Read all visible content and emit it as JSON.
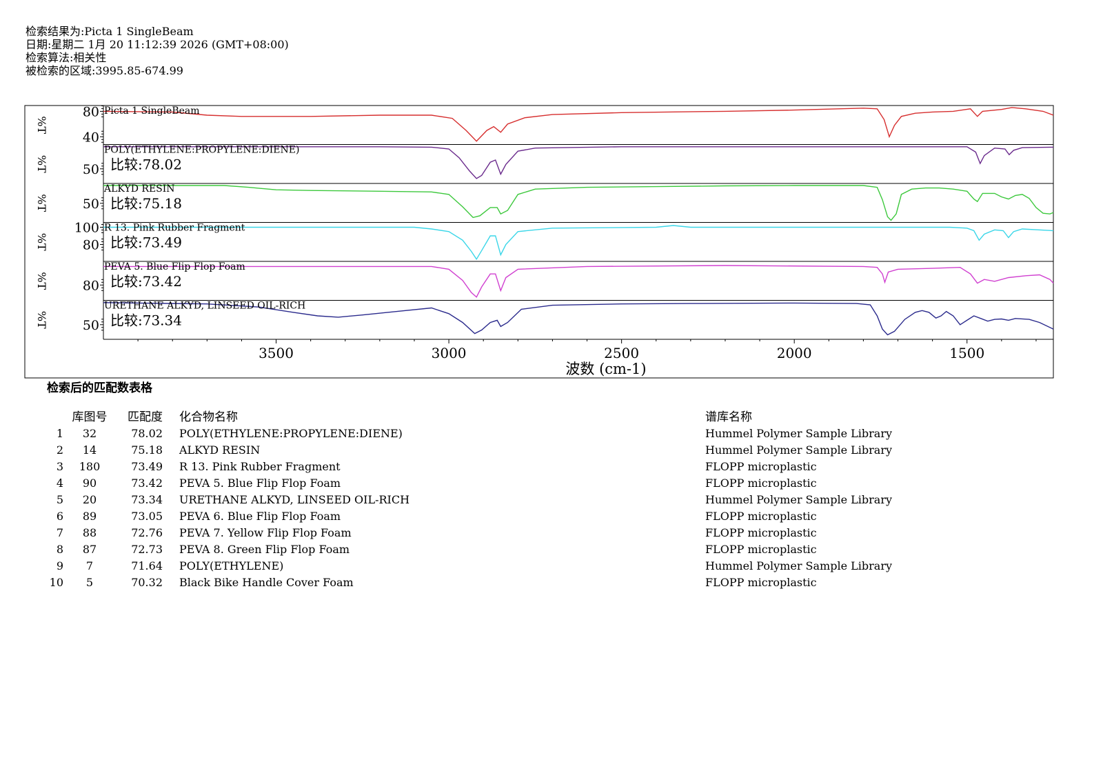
{
  "header": {
    "line1": "检索结果为:Picta 1 SingleBeam",
    "line2": "日期:星期二 1月 20 11:12:39 2026 (GMT+08:00)",
    "line3": "检索算法:相关性",
    "line4": "被检索的区域:3995.85-674.99"
  },
  "chart_data": {
    "type": "line",
    "xlabel": "波数 (cm-1)",
    "ylabel": "%T",
    "x_reversed": true,
    "xlim": [
      4000,
      1250
    ],
    "x_ticks": [
      3500,
      3000,
      2500,
      2000,
      1500
    ],
    "match_prefix": "比较:",
    "series": [
      {
        "name": "Picta 1 SingleBeam",
        "color": "#d62e2e",
        "score": "",
        "y_ticks": [
          80,
          40
        ],
        "ylim": [
          30,
          87
        ],
        "points": [
          [
            4000,
            80
          ],
          [
            3800,
            79
          ],
          [
            3700,
            74
          ],
          [
            3600,
            72
          ],
          [
            3400,
            72
          ],
          [
            3200,
            74
          ],
          [
            3050,
            74
          ],
          [
            2990,
            69
          ],
          [
            2950,
            50
          ],
          [
            2920,
            33
          ],
          [
            2890,
            50
          ],
          [
            2870,
            56
          ],
          [
            2850,
            47
          ],
          [
            2830,
            60
          ],
          [
            2780,
            70
          ],
          [
            2700,
            75
          ],
          [
            2500,
            78
          ],
          [
            2200,
            80
          ],
          [
            2000,
            82
          ],
          [
            1800,
            85
          ],
          [
            1760,
            84
          ],
          [
            1740,
            67
          ],
          [
            1725,
            40
          ],
          [
            1710,
            58
          ],
          [
            1690,
            72
          ],
          [
            1650,
            77
          ],
          [
            1600,
            79
          ],
          [
            1540,
            80
          ],
          [
            1490,
            84
          ],
          [
            1470,
            72
          ],
          [
            1455,
            80
          ],
          [
            1400,
            83
          ],
          [
            1370,
            86
          ],
          [
            1330,
            84
          ],
          [
            1280,
            80
          ],
          [
            1250,
            74
          ]
        ]
      },
      {
        "name": "POLY(ETHYLENE:PROPYLENE:DIENE)",
        "color": "#6a2a8c",
        "score": "78.02",
        "y_ticks": [
          50
        ],
        "ylim": [
          20,
          102
        ],
        "points": [
          [
            4000,
            100
          ],
          [
            3200,
            100
          ],
          [
            3050,
            99
          ],
          [
            3000,
            95
          ],
          [
            2970,
            75
          ],
          [
            2940,
            45
          ],
          [
            2920,
            28
          ],
          [
            2905,
            35
          ],
          [
            2880,
            65
          ],
          [
            2865,
            70
          ],
          [
            2850,
            38
          ],
          [
            2835,
            60
          ],
          [
            2800,
            90
          ],
          [
            2750,
            97
          ],
          [
            2500,
            100
          ],
          [
            1500,
            100
          ],
          [
            1475,
            88
          ],
          [
            1462,
            62
          ],
          [
            1450,
            80
          ],
          [
            1420,
            97
          ],
          [
            1390,
            95
          ],
          [
            1378,
            82
          ],
          [
            1365,
            92
          ],
          [
            1340,
            98
          ],
          [
            1250,
            99
          ]
        ]
      },
      {
        "name": "ALKYD RESIN",
        "color": "#3cc83c",
        "score": "75.18",
        "y_ticks": [
          50
        ],
        "ylim": [
          0,
          102
        ],
        "points": [
          [
            4000,
            100
          ],
          [
            3650,
            100
          ],
          [
            3580,
            95
          ],
          [
            3500,
            88
          ],
          [
            3400,
            86
          ],
          [
            3200,
            84
          ],
          [
            3050,
            82
          ],
          [
            3000,
            75
          ],
          [
            2960,
            40
          ],
          [
            2930,
            10
          ],
          [
            2910,
            15
          ],
          [
            2880,
            38
          ],
          [
            2860,
            38
          ],
          [
            2850,
            20
          ],
          [
            2830,
            30
          ],
          [
            2800,
            75
          ],
          [
            2750,
            90
          ],
          [
            2600,
            95
          ],
          [
            2400,
            97
          ],
          [
            2200,
            99
          ],
          [
            2000,
            100
          ],
          [
            1800,
            100
          ],
          [
            1760,
            95
          ],
          [
            1745,
            60
          ],
          [
            1730,
            12
          ],
          [
            1720,
            2
          ],
          [
            1705,
            20
          ],
          [
            1690,
            75
          ],
          [
            1660,
            90
          ],
          [
            1620,
            93
          ],
          [
            1580,
            93
          ],
          [
            1540,
            90
          ],
          [
            1500,
            84
          ],
          [
            1480,
            62
          ],
          [
            1470,
            55
          ],
          [
            1455,
            78
          ],
          [
            1420,
            78
          ],
          [
            1400,
            68
          ],
          [
            1380,
            62
          ],
          [
            1360,
            72
          ],
          [
            1340,
            75
          ],
          [
            1320,
            64
          ],
          [
            1300,
            38
          ],
          [
            1280,
            22
          ],
          [
            1260,
            20
          ],
          [
            1250,
            24
          ]
        ]
      },
      {
        "name": "R 13. Pink Rubber Fragment",
        "color": "#3ad6e8",
        "score": "73.49",
        "y_ticks": [
          100,
          80
        ],
        "ylim": [
          62,
          104
        ],
        "points": [
          [
            4000,
            100
          ],
          [
            3100,
            100
          ],
          [
            3050,
            98
          ],
          [
            3000,
            95
          ],
          [
            2960,
            85
          ],
          [
            2935,
            72
          ],
          [
            2920,
            63
          ],
          [
            2905,
            73
          ],
          [
            2880,
            90
          ],
          [
            2865,
            90
          ],
          [
            2850,
            68
          ],
          [
            2835,
            80
          ],
          [
            2800,
            95
          ],
          [
            2700,
            99
          ],
          [
            2400,
            100
          ],
          [
            2350,
            102
          ],
          [
            2300,
            100
          ],
          [
            1550,
            100
          ],
          [
            1500,
            99
          ],
          [
            1480,
            96
          ],
          [
            1465,
            85
          ],
          [
            1450,
            92
          ],
          [
            1420,
            97
          ],
          [
            1395,
            96
          ],
          [
            1380,
            88
          ],
          [
            1365,
            95
          ],
          [
            1340,
            98
          ],
          [
            1250,
            96
          ]
        ]
      },
      {
        "name": "PEVA 5. Blue Flip Flop Foam",
        "color": "#d040d0",
        "score": "73.42",
        "y_ticks": [
          80
        ],
        "ylim": [
          65,
          104
        ],
        "points": [
          [
            4000,
            100
          ],
          [
            3050,
            100
          ],
          [
            3000,
            97
          ],
          [
            2960,
            85
          ],
          [
            2935,
            72
          ],
          [
            2920,
            67
          ],
          [
            2905,
            78
          ],
          [
            2880,
            92
          ],
          [
            2865,
            92
          ],
          [
            2850,
            74
          ],
          [
            2835,
            88
          ],
          [
            2800,
            97
          ],
          [
            2600,
            100
          ],
          [
            2200,
            101
          ],
          [
            1800,
            100
          ],
          [
            1760,
            99
          ],
          [
            1745,
            92
          ],
          [
            1738,
            83
          ],
          [
            1728,
            94
          ],
          [
            1700,
            97
          ],
          [
            1600,
            98
          ],
          [
            1520,
            99
          ],
          [
            1490,
            92
          ],
          [
            1470,
            82
          ],
          [
            1450,
            86
          ],
          [
            1420,
            84
          ],
          [
            1380,
            88
          ],
          [
            1330,
            90
          ],
          [
            1290,
            91
          ],
          [
            1260,
            86
          ],
          [
            1250,
            82
          ]
        ]
      },
      {
        "name": "URETHANE ALKYD, LINSEED OIL-RICH",
        "color": "#2a2a8c",
        "score": "73.34",
        "y_ticks": [
          50
        ],
        "ylim": [
          20,
          102
        ],
        "points": [
          [
            4000,
            100
          ],
          [
            3700,
            97
          ],
          [
            3550,
            90
          ],
          [
            3450,
            78
          ],
          [
            3380,
            70
          ],
          [
            3320,
            67
          ],
          [
            3250,
            72
          ],
          [
            3150,
            80
          ],
          [
            3050,
            88
          ],
          [
            3000,
            75
          ],
          [
            2960,
            55
          ],
          [
            2925,
            30
          ],
          [
            2905,
            38
          ],
          [
            2880,
            55
          ],
          [
            2860,
            60
          ],
          [
            2850,
            46
          ],
          [
            2830,
            55
          ],
          [
            2790,
            85
          ],
          [
            2700,
            94
          ],
          [
            2500,
            97
          ],
          [
            2300,
            98
          ],
          [
            2000,
            99
          ],
          [
            1820,
            98
          ],
          [
            1780,
            95
          ],
          [
            1760,
            70
          ],
          [
            1745,
            40
          ],
          [
            1730,
            27
          ],
          [
            1710,
            35
          ],
          [
            1680,
            62
          ],
          [
            1650,
            78
          ],
          [
            1630,
            82
          ],
          [
            1610,
            78
          ],
          [
            1590,
            65
          ],
          [
            1575,
            70
          ],
          [
            1560,
            80
          ],
          [
            1540,
            70
          ],
          [
            1520,
            50
          ],
          [
            1500,
            60
          ],
          [
            1480,
            70
          ],
          [
            1460,
            64
          ],
          [
            1440,
            58
          ],
          [
            1420,
            62
          ],
          [
            1400,
            63
          ],
          [
            1380,
            60
          ],
          [
            1360,
            64
          ],
          [
            1320,
            62
          ],
          [
            1290,
            55
          ],
          [
            1250,
            40
          ]
        ]
      }
    ]
  },
  "table": {
    "title": "检索后的匹配数表格",
    "headers": {
      "lib": "库图号",
      "score": "匹配度",
      "name": "化合物名称",
      "lname": "谱库名称"
    },
    "rows": [
      {
        "idx": "1",
        "lib": "32",
        "score": "78.02",
        "name": "POLY(ETHYLENE:PROPYLENE:DIENE)",
        "lname": "Hummel Polymer Sample Library"
      },
      {
        "idx": "2",
        "lib": "14",
        "score": "75.18",
        "name": "ALKYD RESIN",
        "lname": "Hummel Polymer Sample Library"
      },
      {
        "idx": "3",
        "lib": "180",
        "score": "73.49",
        "name": "R 13. Pink Rubber Fragment",
        "lname": "FLOPP microplastic"
      },
      {
        "idx": "4",
        "lib": "90",
        "score": "73.42",
        "name": "PEVA 5. Blue Flip Flop Foam",
        "lname": "FLOPP microplastic"
      },
      {
        "idx": "5",
        "lib": "20",
        "score": "73.34",
        "name": "URETHANE ALKYD, LINSEED OIL-RICH",
        "lname": "Hummel Polymer Sample Library"
      },
      {
        "idx": "6",
        "lib": "89",
        "score": "73.05",
        "name": "PEVA 6. Blue Flip Flop Foam",
        "lname": "FLOPP microplastic"
      },
      {
        "idx": "7",
        "lib": "88",
        "score": "72.76",
        "name": "PEVA 7. Yellow Flip Flop Foam",
        "lname": "FLOPP microplastic"
      },
      {
        "idx": "8",
        "lib": "87",
        "score": "72.73",
        "name": "PEVA 8. Green Flip Flop Foam",
        "lname": "FLOPP microplastic"
      },
      {
        "idx": "9",
        "lib": "7",
        "score": "71.64",
        "name": "POLY(ETHYLENE)",
        "lname": "Hummel Polymer Sample Library"
      },
      {
        "idx": "10",
        "lib": "5",
        "score": "70.32",
        "name": "Black Bike Handle Cover Foam",
        "lname": "FLOPP microplastic"
      }
    ]
  }
}
